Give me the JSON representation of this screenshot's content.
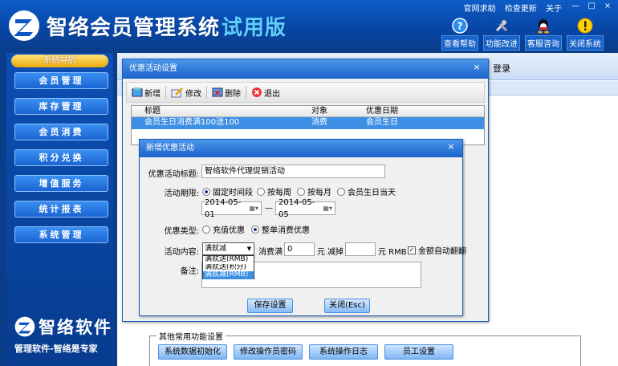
{
  "app": {
    "title": "智络会员管理系统",
    "trial": "试用版",
    "top_links": [
      "官网求助",
      "检查更新",
      "关于"
    ],
    "window_controls": [
      "—",
      "□",
      "×"
    ],
    "tools": [
      {
        "label": "查看帮助",
        "icon": "help-icon"
      },
      {
        "label": "功能改进",
        "icon": "tools-icon"
      },
      {
        "label": "客服咨询",
        "icon": "qq-icon"
      },
      {
        "label": "关闭系统",
        "icon": "warning-icon"
      }
    ]
  },
  "sidebar": {
    "header": "系统导航",
    "items": [
      "会员管理",
      "库存管理",
      "会员消费",
      "积分兑换",
      "增值服务",
      "统计报表",
      "系统管理"
    ],
    "brand_name": "智络软件",
    "brand_tagline": "管理软件-智络是专家"
  },
  "main": {
    "login_label": "登录",
    "other_settings": {
      "title": "其他常用功能设置",
      "buttons": [
        "系统数据初始化",
        "修改操作员密码",
        "系统操作日志",
        "员工设置"
      ]
    }
  },
  "promo_dialog": {
    "title": "优惠活动设置",
    "close": "×",
    "toolbar": [
      "新增",
      "修改",
      "删除",
      "退出"
    ],
    "columns": [
      "标题",
      "对象",
      "优惠日期"
    ],
    "rows": [
      {
        "title": "会员生日消费满100送100",
        "target": "消费",
        "date": "会员生日"
      }
    ]
  },
  "new_promo_dialog": {
    "title": "新增优惠活动",
    "close": "×",
    "labels": {
      "title": "优惠活动标题:",
      "period": "活动期限:",
      "type": "优惠类型:",
      "content": "活动内容:",
      "remark": "备注:"
    },
    "title_value": "智络软件代理促销活动",
    "period_options": [
      "固定时间段",
      "按每周",
      "按每月",
      "会员生日当天"
    ],
    "period_selected": 0,
    "date_from": "2014-05-01",
    "date_separator": "—",
    "date_to": "2014-05-05",
    "type_options": [
      "充值优惠",
      "整单消费优惠"
    ],
    "type_selected": 1,
    "content_combo": "满就减(RMB)",
    "content_options": [
      "满就送(RMB)",
      "满就送(积分)",
      "满就减(RMB)"
    ],
    "content_selected": 2,
    "spend_label": "消费满",
    "spend_value": "0",
    "unit1": "元",
    "reduce_label": "减掉",
    "reduce_value": "",
    "unit2": "元 RMB",
    "auto_round_label": "金额自动翻翻",
    "auto_round_checked": "✓",
    "save_button": "保存设置",
    "close_button": "关闭(Esc)"
  }
}
